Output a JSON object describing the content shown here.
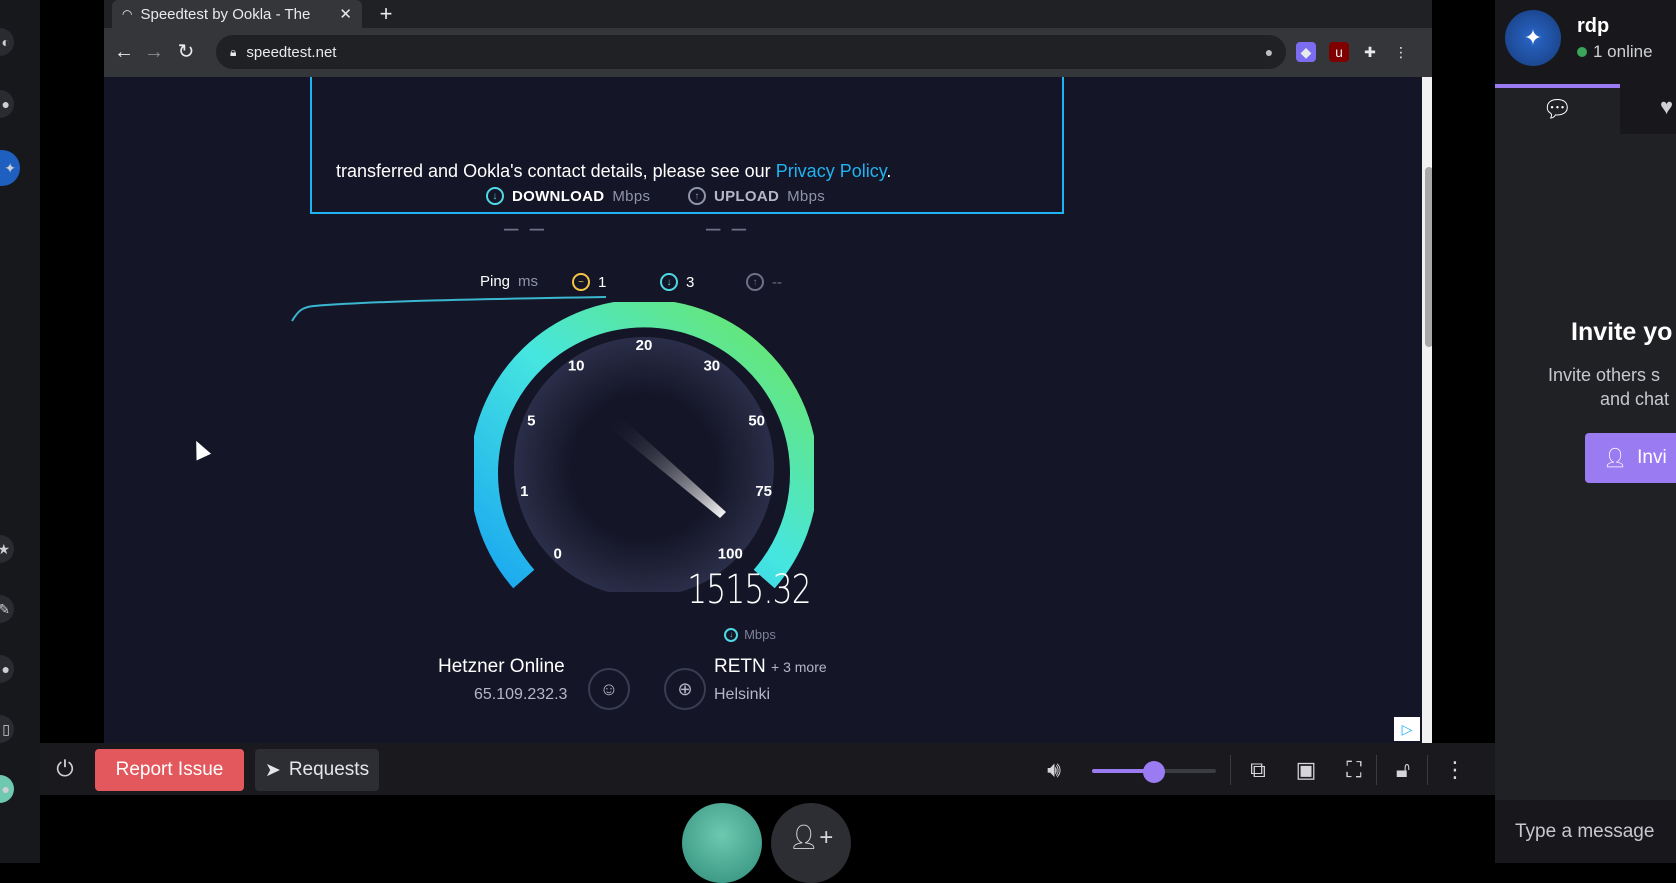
{
  "browser": {
    "tab_title": "Speedtest by Ookla - The",
    "url": "speedtest.net"
  },
  "notice": {
    "text": "transferred and Ookla's contact details, please see our ",
    "link": "Privacy Policy",
    "tail": "."
  },
  "speedtest": {
    "download_label": "DOWNLOAD",
    "download_unit": "Mbps",
    "download_value": "– –",
    "upload_label": "UPLOAD",
    "upload_unit": "Mbps",
    "upload_value": "– –",
    "ping_label": "Ping",
    "ping_unit": "ms",
    "ping_idle": "1",
    "ping_download": "3",
    "ping_upload": "--",
    "gauge_ticks": [
      "0",
      "1",
      "5",
      "10",
      "20",
      "30",
      "50",
      "75",
      "100"
    ],
    "readout": "1515.32",
    "readout_unit": "Mbps",
    "isp_name": "Hetzner Online",
    "isp_ip": "65.109.232.3",
    "server_name": "RETN",
    "server_more": "+ 3 more",
    "server_city": "Helsinki"
  },
  "controls": {
    "report_label": "Report Issue",
    "requests_label": "Requests",
    "volume": 0.5
  },
  "sidebar": {
    "room_name": "rdp",
    "online_count": "1 online",
    "title": "Invite yo",
    "desc_line1": "Invite others s",
    "desc_line2": "and chat",
    "invite_label": "Invi",
    "message_placeholder": "Type a message"
  },
  "colors": {
    "accent": "#9b7bf2",
    "report": "#e2585c",
    "speedtest_blue": "#1fb4f1"
  }
}
